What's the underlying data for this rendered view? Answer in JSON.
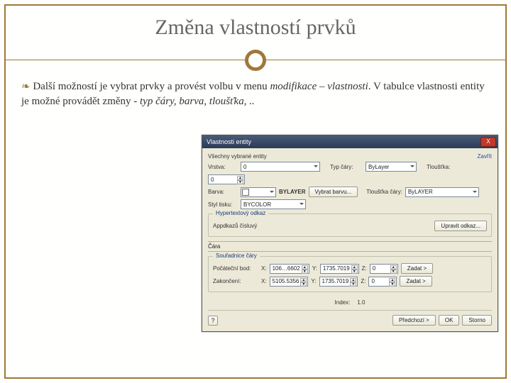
{
  "slide": {
    "title": "Změna vlastností prvků",
    "bullet_lead": "Další možností je vybrat prvky a provést volbu v menu ",
    "bullet_em1": "modifikace – vlastnosti",
    "bullet_mid": ". V tabulce vlastnosti entity je možné provádět změny - ",
    "bullet_em2": "typ čáry, barva, tloušťka, .."
  },
  "dialog": {
    "title": "Vlastnosti entity",
    "top_note": "Všechny vybrané entity",
    "all_label": "Zavřít",
    "vrstva": {
      "label": "Vrstva:",
      "value": "0"
    },
    "typcary": {
      "label": "Typ čáry:",
      "value": "ByLayer"
    },
    "tloustka": {
      "label": "Tloušťka:",
      "value": "0"
    },
    "barva": {
      "label": "Barva:",
      "value": "BYLAYER",
      "btn": "Vybrat barvu..."
    },
    "tloustkacary": {
      "label": "Tloušťka čáry:",
      "value": "ByLAYER"
    },
    "styltisku": {
      "label": "Styl tisku:",
      "value": "BYCOLOR"
    },
    "hyper": {
      "title": "Hypertextový odkaz",
      "value": "Appdkazů čísluvý",
      "btn": "Upravit odkaz..."
    },
    "cara": {
      "title": "Čára",
      "sub": "Souřadnice čáry"
    },
    "pocatek": {
      "label": "Počáteční bod:",
      "x": "106…6602",
      "y": "1735.7019",
      "z": "0",
      "btn": "Zadat >"
    },
    "zakonceni": {
      "label": "Zakončení:",
      "x": "5105.5356",
      "y": "1735.7019",
      "z": "0",
      "btn": "Zadat >"
    },
    "index": {
      "label": "Index:",
      "value": "1.0"
    },
    "footer": {
      "predchozi": "Předchozí >",
      "ok": "OK",
      "storno": "Storno"
    }
  }
}
